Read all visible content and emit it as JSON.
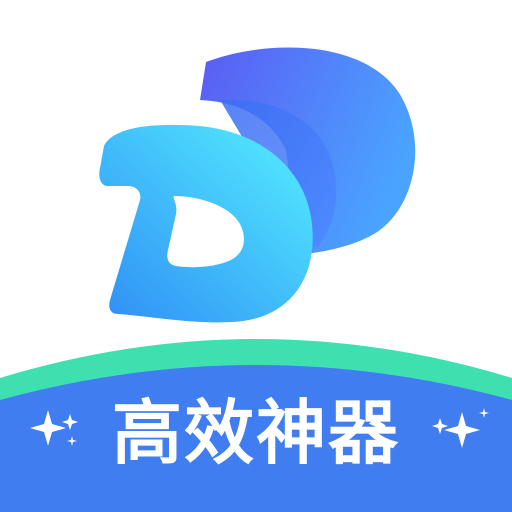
{
  "app_icon": {
    "slogan": "高效神器",
    "logo_icon": "double-d-logo-icon",
    "sparkle_icon": "sparkle-icon"
  },
  "colors": {
    "background": "#ffffff",
    "back_d_start": "#5b5cf4",
    "back_d_end": "#4aa3ff",
    "front_d_start": "#2f8ef5",
    "front_d_end": "#55f0ff",
    "banner_top": "#3ee0b0",
    "banner_bottom": "#3f7df0",
    "sparkle": "#ffffff"
  }
}
